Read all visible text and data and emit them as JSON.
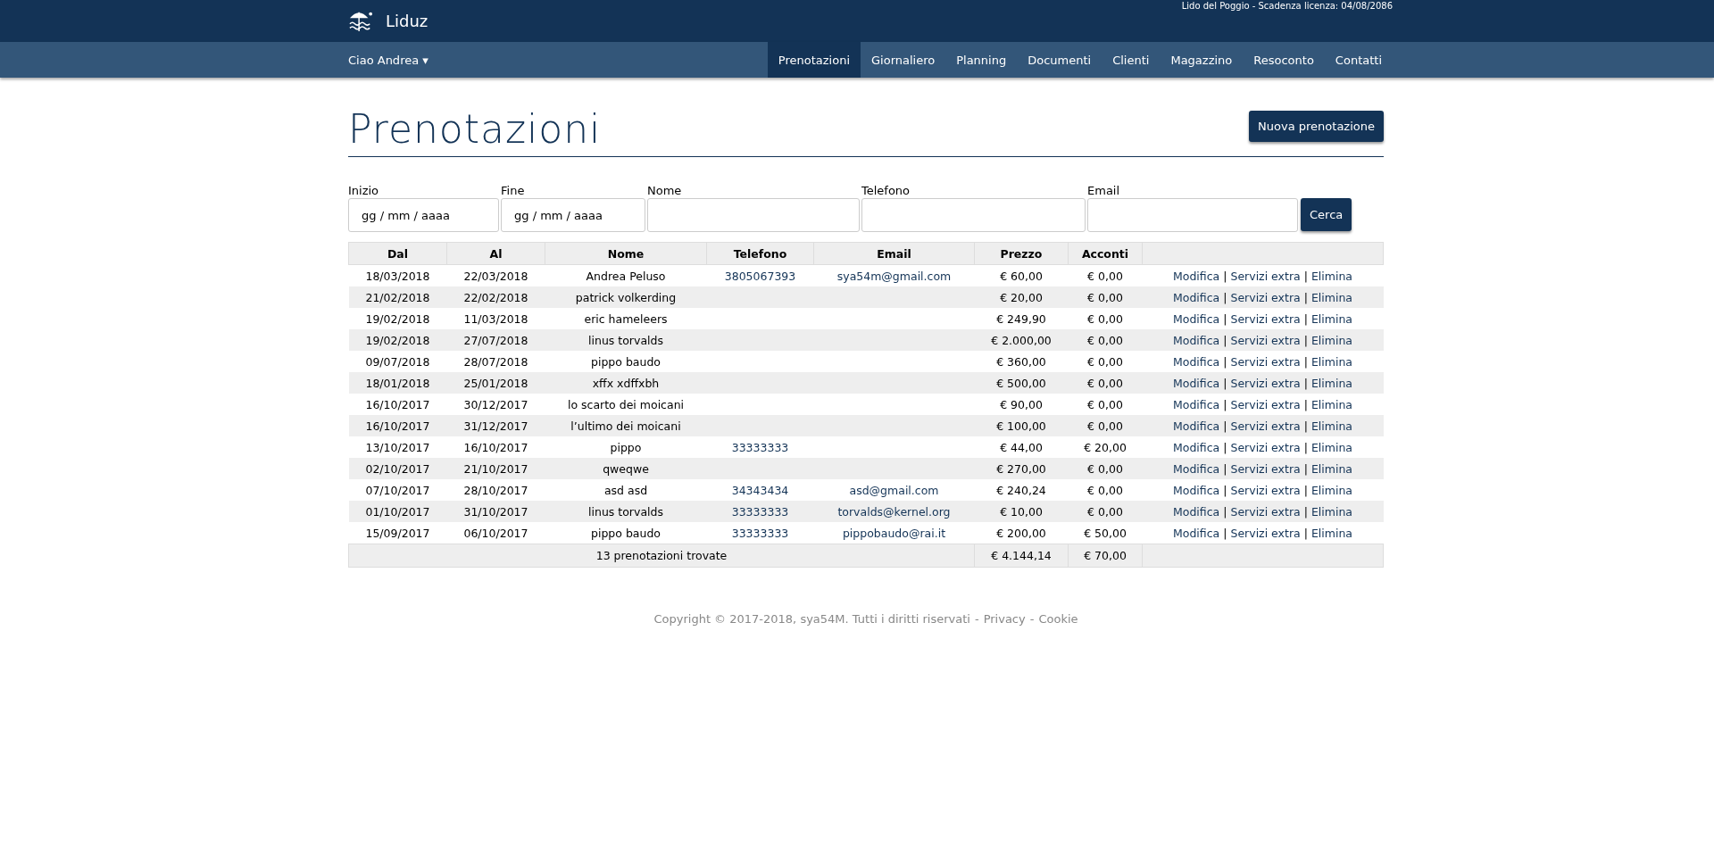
{
  "header": {
    "brand": "Liduz",
    "license": "Lido del Poggio - Scadenza licenza: 04/08/2086"
  },
  "navbar": {
    "user_menu": "Ciao Andrea ▾",
    "items": [
      {
        "label": "Prenotazioni",
        "selected": true
      },
      {
        "label": "Giornaliero",
        "selected": false
      },
      {
        "label": "Planning",
        "selected": false
      },
      {
        "label": "Documenti",
        "selected": false
      },
      {
        "label": "Clienti",
        "selected": false
      },
      {
        "label": "Magazzino",
        "selected": false
      },
      {
        "label": "Resoconto",
        "selected": false
      },
      {
        "label": "Contatti",
        "selected": false
      }
    ]
  },
  "page": {
    "title": "Prenotazioni",
    "new_button": "Nuova prenotazione"
  },
  "search_form": {
    "fields": [
      {
        "label": "Inizio",
        "placeholder": "gg / mm / aaaa"
      },
      {
        "label": "Fine",
        "placeholder": "gg / mm / aaaa"
      },
      {
        "label": "Nome"
      },
      {
        "label": "Telefono"
      },
      {
        "label": "Email"
      }
    ],
    "button": "Cerca"
  },
  "table": {
    "columns": [
      "Dal",
      "Al",
      "Nome",
      "Telefono",
      "Email",
      "Prezzo",
      "Acconti"
    ],
    "action_separator": "|",
    "rows": [
      {
        "dal": "18/03/2018",
        "al": "22/03/2018",
        "nome": "Andrea Peluso",
        "telefono": "3805067393",
        "email": "sya54m@gmail.com",
        "prezzo": "€ 60,00",
        "acconti": "€ 0,00",
        "actions": [
          "Modifica",
          "Servizi extra",
          "Elimina"
        ]
      },
      {
        "dal": "21/02/2018",
        "al": "22/02/2018",
        "nome": "patrick volkerding",
        "prezzo": "€ 20,00",
        "acconti": "€ 0,00",
        "actions": [
          "Modifica",
          "Servizi extra",
          "Elimina"
        ]
      },
      {
        "dal": "19/02/2018",
        "al": "11/03/2018",
        "nome": "eric hameleers",
        "prezzo": "€ 249,90",
        "acconti": "€ 0,00",
        "actions": [
          "Modifica",
          "Servizi extra",
          "Elimina"
        ]
      },
      {
        "dal": "19/02/2018",
        "al": "27/07/2018",
        "nome": "linus torvalds",
        "prezzo": "€ 2.000,00",
        "acconti": "€ 0,00",
        "actions": [
          "Modifica",
          "Servizi extra",
          "Elimina"
        ]
      },
      {
        "dal": "09/07/2018",
        "al": "28/07/2018",
        "nome": "pippo baudo",
        "prezzo": "€ 360,00",
        "acconti": "€ 0,00",
        "actions": [
          "Modifica",
          "Servizi extra",
          "Elimina"
        ]
      },
      {
        "dal": "18/01/2018",
        "al": "25/01/2018",
        "nome": "xffx xdffxbh",
        "prezzo": "€ 500,00",
        "acconti": "€ 0,00",
        "actions": [
          "Modifica",
          "Servizi extra",
          "Elimina"
        ]
      },
      {
        "dal": "16/10/2017",
        "al": "30/12/2017",
        "nome": "lo scarto dei moicani",
        "prezzo": "€ 90,00",
        "acconti": "€ 0,00",
        "actions": [
          "Modifica",
          "Servizi extra",
          "Elimina"
        ]
      },
      {
        "dal": "16/10/2017",
        "al": "31/12/2017",
        "nome": "l’ultimo dei moicani",
        "prezzo": "€ 100,00",
        "acconti": "€ 0,00",
        "actions": [
          "Modifica",
          "Servizi extra",
          "Elimina"
        ]
      },
      {
        "dal": "13/10/2017",
        "al": "16/10/2017",
        "nome": "pippo",
        "telefono": "33333333",
        "prezzo": "€ 44,00",
        "acconti": "€ 20,00",
        "actions": [
          "Modifica",
          "Servizi extra",
          "Elimina"
        ]
      },
      {
        "dal": "02/10/2017",
        "al": "21/10/2017",
        "nome": "qweqwe",
        "prezzo": "€ 270,00",
        "acconti": "€ 0,00",
        "actions": [
          "Modifica",
          "Servizi extra",
          "Elimina"
        ]
      },
      {
        "dal": "07/10/2017",
        "al": "28/10/2017",
        "nome": "asd asd",
        "telefono": "34343434",
        "email": "asd@gmail.com",
        "prezzo": "€ 240,24",
        "acconti": "€ 0,00",
        "actions": [
          "Modifica",
          "Servizi extra",
          "Elimina"
        ]
      },
      {
        "dal": "01/10/2017",
        "al": "31/10/2017",
        "nome": "linus torvalds",
        "telefono": "33333333",
        "email": "torvalds@kernel.org",
        "prezzo": "€ 10,00",
        "acconti": "€ 0,00",
        "actions": [
          "Modifica",
          "Servizi extra",
          "Elimina"
        ]
      },
      {
        "dal": "15/09/2017",
        "al": "06/10/2017",
        "nome": "pippo baudo",
        "telefono": "33333333",
        "email": "pippobaudo@rai.it",
        "prezzo": "€ 200,00",
        "acconti": "€ 50,00",
        "actions": [
          "Modifica",
          "Servizi extra",
          "Elimina"
        ]
      }
    ],
    "footer": {
      "count": "13 prenotazioni trovate",
      "prezzo_total": "€ 4.144,14",
      "acconti_total": "€ 70,00"
    }
  },
  "footer": {
    "copyright": "Copyright © 2017-2018, sya54M. Tutti i diritti riservati",
    "separator_1": "-",
    "privacy": "Privacy",
    "separator_2": "-",
    "cookie": "Cookie"
  }
}
